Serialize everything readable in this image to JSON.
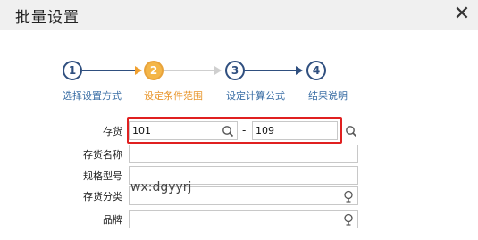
{
  "window": {
    "title": "批量设置",
    "close_glyph": "✕"
  },
  "steps": [
    {
      "number": "1",
      "label": "选择设置方式",
      "state": "done"
    },
    {
      "number": "2",
      "label": "设定条件范围",
      "state": "active"
    },
    {
      "number": "3",
      "label": "设定计算公式",
      "state": "pending"
    },
    {
      "number": "4",
      "label": "结果说明",
      "state": "pending"
    }
  ],
  "form": {
    "inventory": {
      "label": "存货",
      "from": "101",
      "separator": "-",
      "to": "109"
    },
    "inventory_name": {
      "label": "存货名称",
      "value": ""
    },
    "spec_model": {
      "label": "规格型号",
      "value": ""
    },
    "inventory_category": {
      "label": "存货分类",
      "value": ""
    },
    "brand": {
      "label": "品牌",
      "value": ""
    }
  },
  "overlay_text": "wx:dgyyrj",
  "colors": {
    "accent": "#f4b648",
    "step_dark": "#2f4f7f",
    "step_label": "#3a6ea5",
    "highlight": "#e02020"
  },
  "icons": {
    "search": "search-icon",
    "lookup": "lookup-icon",
    "close": "close-icon"
  }
}
